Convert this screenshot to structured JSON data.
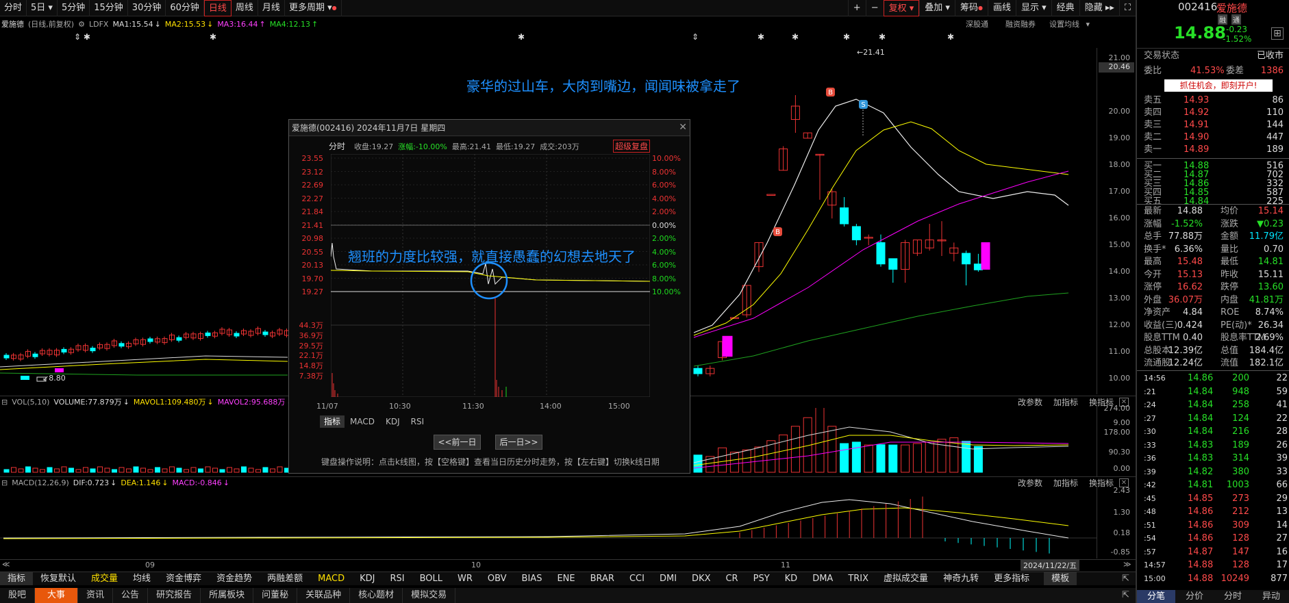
{
  "toolbar": {
    "periods": [
      "分时",
      "5日",
      "5分钟",
      "15分钟",
      "30分钟",
      "60分钟",
      "日线",
      "周线",
      "月线",
      "更多周期"
    ],
    "right": [
      "+",
      "−",
      "复权",
      "叠加",
      "筹码",
      "画线",
      "显示",
      "经典",
      "隐藏"
    ]
  },
  "info": {
    "name": "爱施德",
    "mode": "(日线,前复权)",
    "ldfx": "LDFX",
    "ma1": "MA1:15.54",
    "ma2": "MA2:15.53",
    "ma3": "MA3:16.44",
    "ma4": "MA4:12.13",
    "deep": "深股通",
    "rzrq": "融资融券",
    "setma": "设置均线"
  },
  "price_axis": [
    "21.00",
    "20.46",
    "20.00",
    "19.00",
    "18.00",
    "17.00",
    "16.00",
    "15.00",
    "14.00",
    "13.00",
    "12.00",
    "11.00",
    "10.00",
    "9.00"
  ],
  "price_axis_ticks": [
    "21.00",
    "20.00",
    "19.00",
    "18.00",
    "17.00",
    "16.00",
    "15.00",
    "14.00",
    "13.00",
    "12.00",
    "11.00",
    "10.00",
    "9.00"
  ],
  "current_price_tag": "20.46",
  "chart_labels": {
    "high": "21.41",
    "low": "8.80",
    "annot_top": "豪华的过山车，大肉到嘴边，闻闻味被拿走了",
    "annot_popup": "翘班的力度比较强，就直接愚蠢的幻想去地天了",
    "b": "B",
    "s": "S"
  },
  "volume_panel": {
    "hdr": "VOL(5,10)",
    "volume": "VOLUME:77.879万",
    "mavol1": "MAVOL1:109.480万",
    "mavol2": "MAVOL2:95.688万",
    "axis": [
      "274.00",
      "178.00",
      "90.30",
      "0.00"
    ],
    "btns": [
      "改参数",
      "加指标",
      "换指标"
    ]
  },
  "macd_panel": {
    "hdr": "MACD(12,26,9)",
    "dif": "DIF:0.723",
    "dea": "DEA:1.146",
    "macd": "MACD:-0.846",
    "axis": [
      "2.43",
      "1.30",
      "0.18",
      "-0.85"
    ],
    "btns": [
      "改参数",
      "加指标",
      "换指标"
    ]
  },
  "x_axis": {
    "labels": [
      "09",
      "10",
      "11"
    ],
    "date": "2024/11/22/五"
  },
  "popup": {
    "title": "爱施德(002416) 2024年11月7日 星期四",
    "tab": "分时",
    "close_price": "收盘:19.27",
    "change": "涨幅:-10.00%",
    "high": "最高:21.41",
    "low": "最低:19.27",
    "volume": "成交:203万",
    "super": "超级复盘",
    "left_axis": [
      "23.55",
      "23.12",
      "22.69",
      "22.27",
      "21.84",
      "21.41",
      "20.98",
      "20.55",
      "20.13",
      "19.70",
      "19.27"
    ],
    "right_axis": [
      "10.00%",
      "8.00%",
      "6.00%",
      "4.00%",
      "2.00%",
      "0.00%",
      "2.00%",
      "4.00%",
      "6.00%",
      "8.00%",
      "10.00%"
    ],
    "vol_axis": [
      "44.3万",
      "36.9万",
      "29.5万",
      "22.1万",
      "14.8万",
      "7.38万"
    ],
    "times": [
      "11/07",
      "10:30",
      "11:30",
      "14:00",
      "15:00"
    ],
    "tabs": [
      "指标",
      "MACD",
      "KDJ",
      "RSI"
    ],
    "prev": "<<前一日",
    "next": "后一日>>",
    "help": "键盘操作说明：点击k线图，按【空格键】查看当日历史分时走势，按【左右键】切换k线日期"
  },
  "indicator_tabs": [
    "指标",
    "恢复默认",
    "成交量",
    "均线",
    "资金博弈",
    "资金趋势",
    "两融差额",
    "MACD",
    "KDJ",
    "RSI",
    "BOLL",
    "WR",
    "OBV",
    "BIAS",
    "ENE",
    "BRAR",
    "CCI",
    "DMI",
    "DKX",
    "CR",
    "PSY",
    "KD",
    "DMA",
    "TRIX",
    "虚拟成交量",
    "神奇九转",
    "更多指标",
    "模板"
  ],
  "status_tabs": [
    "股吧",
    "大事",
    "资讯",
    "公告",
    "研究报告",
    "所属板块",
    "问董秘",
    "关联品种",
    "核心题材",
    "模拟交易"
  ],
  "right": {
    "code": "002416",
    "name": "爱施德",
    "tags": [
      "融",
      "通"
    ],
    "price": "14.88",
    "change": "-0.23",
    "pct": "-1.52%",
    "state_label": "交易状态",
    "state": "已收市",
    "wb_label": "委比",
    "wb": "41.53%",
    "wc_label": "委差",
    "wc": "1386",
    "promo": "抓住机会，即刻开户!",
    "asks": [
      [
        "卖五",
        "14.93",
        "86"
      ],
      [
        "卖四",
        "14.92",
        "110"
      ],
      [
        "卖三",
        "14.91",
        "144"
      ],
      [
        "卖二",
        "14.90",
        "447"
      ],
      [
        "卖一",
        "14.89",
        "189"
      ]
    ],
    "bids": [
      [
        "买一",
        "14.88",
        "516"
      ],
      [
        "买二",
        "14.87",
        "702"
      ],
      [
        "买三",
        "14.86",
        "332"
      ],
      [
        "买四",
        "14.85",
        "587"
      ],
      [
        "买五",
        "14.84",
        "225"
      ]
    ],
    "stats": [
      [
        "最新",
        "14.88",
        "均价",
        "15.14"
      ],
      [
        "涨幅",
        "-1.52%",
        "涨跌",
        "▼0.23"
      ],
      [
        "总手",
        "77.88万",
        "金额",
        "11.79亿"
      ],
      [
        "换手*",
        "6.36%",
        "量比",
        "0.70"
      ],
      [
        "最高",
        "15.48",
        "最低",
        "14.81"
      ],
      [
        "今开",
        "15.13",
        "昨收",
        "15.11"
      ],
      [
        "涨停",
        "16.62",
        "跌停",
        "13.60"
      ],
      [
        "外盘",
        "36.07万",
        "内盘",
        "41.81万"
      ],
      [
        "净资产",
        "4.84",
        "ROE",
        "8.74%"
      ],
      [
        "收益(三)",
        "0.424",
        "PE(动)*",
        "26.34"
      ],
      [
        "股息TTM",
        "0.40",
        "股息率TTM",
        "2.69%"
      ],
      [
        "总股本",
        "12.39亿",
        "总值",
        "184.4亿"
      ],
      [
        "流通股",
        "12.24亿",
        "流值",
        "182.1亿"
      ]
    ],
    "ticks": [
      [
        "14:56",
        "14.86",
        "200",
        "22"
      ],
      [
        ":21",
        "14.84",
        "948",
        "59"
      ],
      [
        ":24",
        "14.84",
        "258",
        "41"
      ],
      [
        ":27",
        "14.84",
        "124",
        "22"
      ],
      [
        ":30",
        "14.84",
        "216",
        "28"
      ],
      [
        ":33",
        "14.83",
        "189",
        "26"
      ],
      [
        ":36",
        "14.83",
        "314",
        "39"
      ],
      [
        ":39",
        "14.82",
        "380",
        "33"
      ],
      [
        ":42",
        "14.81",
        "1003",
        "66"
      ],
      [
        ":45",
        "14.85",
        "273",
        "29"
      ],
      [
        ":48",
        "14.86",
        "212",
        "13"
      ],
      [
        ":51",
        "14.86",
        "309",
        "14"
      ],
      [
        ":54",
        "14.86",
        "128",
        "27"
      ],
      [
        ":57",
        "14.87",
        "147",
        "16"
      ],
      [
        "14:57",
        "14.88",
        "128",
        "17"
      ],
      [
        "15:00",
        "14.88",
        "10249",
        "877"
      ]
    ],
    "bottom_tabs": [
      "分笔",
      "分价",
      "分时",
      "异动"
    ]
  },
  "chart_data": {
    "type": "candlestick",
    "title": "",
    "note": "daily K-line, last part visible",
    "candles": [
      {
        "o": 11.2,
        "c": 11.0,
        "h": 11.3,
        "l": 10.9
      },
      {
        "o": 11.0,
        "c": 11.2,
        "h": 11.3,
        "l": 10.9
      },
      {
        "o": 11.6,
        "c": 12.2,
        "h": 12.2,
        "l": 11.5
      },
      {
        "o": 13.1,
        "c": 13.1,
        "h": 13.1,
        "l": 13.1
      },
      {
        "o": 13.2,
        "c": 14.3,
        "h": 14.3,
        "l": 13.1
      },
      {
        "o": 15.0,
        "c": 15.9,
        "h": 15.9,
        "l": 14.8
      },
      {
        "o": 17.7,
        "c": 17.7,
        "h": 17.7,
        "l": 17.7
      },
      {
        "o": 18.6,
        "c": 19.4,
        "h": 19.5,
        "l": 18.6
      },
      {
        "o": 20.5,
        "c": 21.0,
        "h": 21.41,
        "l": 20.0
      },
      {
        "o": 19.8,
        "c": 20.0,
        "h": 20.0,
        "l": 19.8
      },
      {
        "o": 19.2,
        "c": 19.2,
        "h": 19.2,
        "l": 17.5
      },
      {
        "o": 17.3,
        "c": 17.8,
        "h": 17.9,
        "l": 16.8
      },
      {
        "o": 17.2,
        "c": 16.6,
        "h": 17.6,
        "l": 16.5
      },
      {
        "o": 16.5,
        "c": 16.0,
        "h": 16.6,
        "l": 15.8
      },
      {
        "o": 16.1,
        "c": 16.1,
        "h": 16.2,
        "l": 15.8
      },
      {
        "o": 15.9,
        "c": 15.1,
        "h": 16.2,
        "l": 15.0
      },
      {
        "o": 15.3,
        "c": 14.9,
        "h": 15.3,
        "l": 14.4
      },
      {
        "o": 14.9,
        "c": 15.9,
        "h": 16.0,
        "l": 14.4
      },
      {
        "o": 15.5,
        "c": 16.0,
        "h": 16.0,
        "l": 15.4
      },
      {
        "o": 15.7,
        "c": 16.0,
        "h": 16.6,
        "l": 15.6
      },
      {
        "o": 16.0,
        "c": 16.0,
        "h": 16.7,
        "l": 15.4
      },
      {
        "o": 15.5,
        "c": 15.7,
        "h": 15.9,
        "l": 15.2
      },
      {
        "o": 15.5,
        "c": 15.1,
        "h": 15.6,
        "l": 14.3
      },
      {
        "o": 15.1,
        "c": 14.88,
        "h": 15.48,
        "l": 14.81
      }
    ],
    "volume": [
      60,
      55,
      85,
      70,
      78,
      88,
      110,
      130,
      160,
      190,
      230,
      160,
      100,
      105,
      95,
      96,
      95,
      95,
      100,
      105,
      115,
      120,
      108,
      90
    ],
    "ylim": [
      8.8,
      21.41
    ]
  }
}
